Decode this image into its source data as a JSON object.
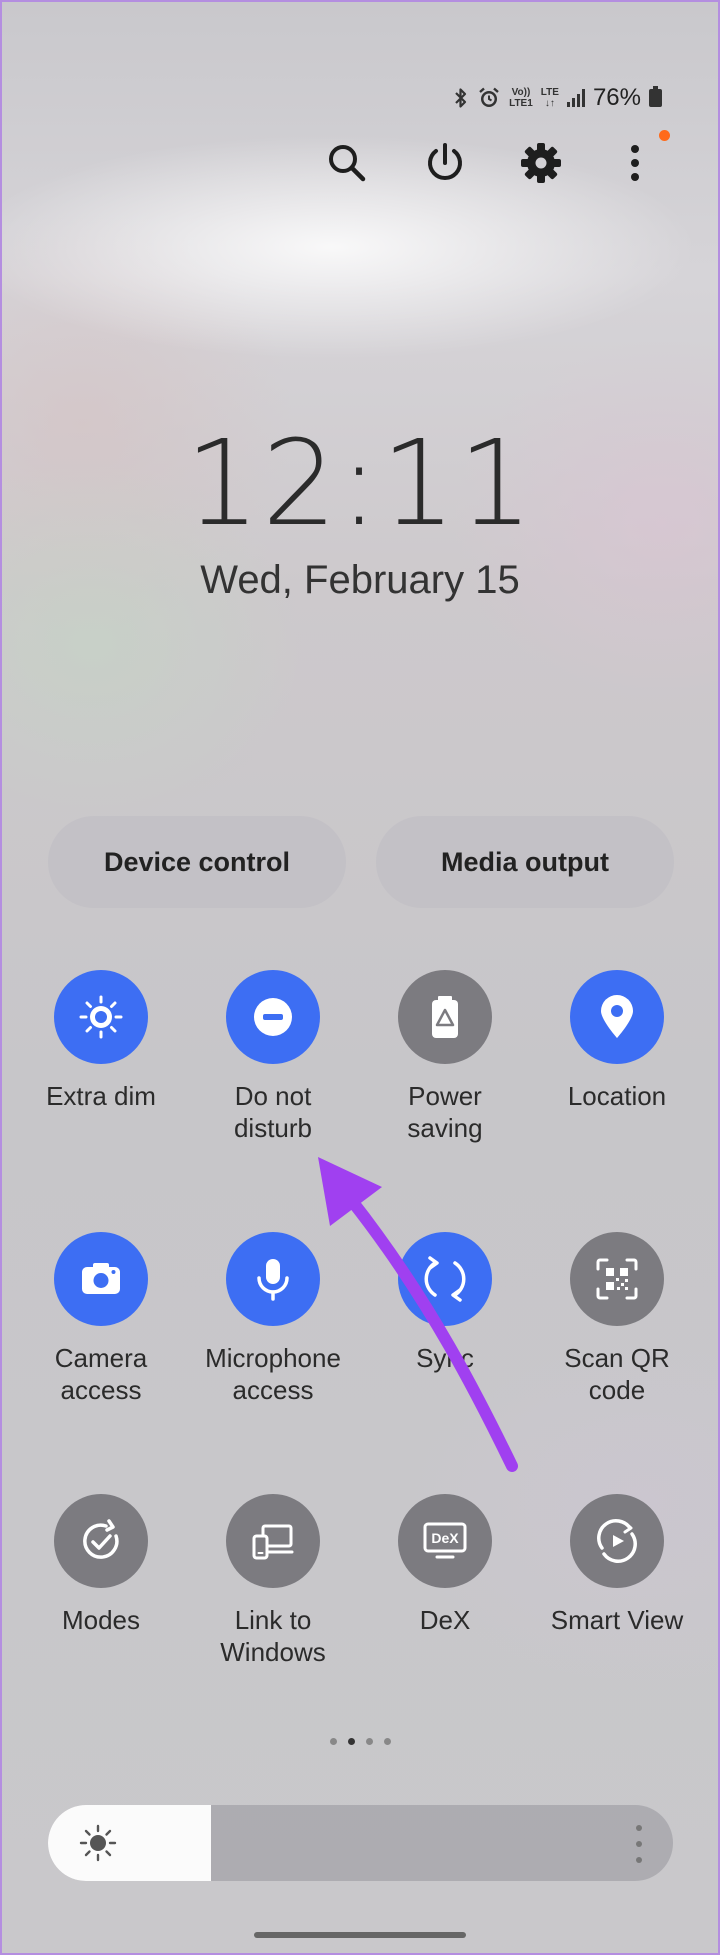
{
  "status_bar": {
    "volte_top": "Vo))",
    "volte_bottom": "LTE1",
    "network": "LTE",
    "battery_percent": "76%",
    "icons": [
      "bluetooth-icon",
      "alarm-icon",
      "volte-icon",
      "lte-icon",
      "signal-icon",
      "battery-icon"
    ]
  },
  "actions": {
    "icons": [
      "search-icon",
      "power-icon",
      "settings-gear-icon",
      "more-vertical-icon"
    ],
    "notification_dot_color": "#ff6a1a"
  },
  "clock": {
    "time": "12:11",
    "date": "Wed, February 15"
  },
  "pills": {
    "device_control": "Device control",
    "media_output": "Media output"
  },
  "tiles": [
    {
      "label": "Extra dim",
      "state": "on",
      "icon": "extra-dim-icon"
    },
    {
      "label": "Do not\ndisturb",
      "state": "on",
      "icon": "do-not-disturb-icon"
    },
    {
      "label": "Power\nsaving",
      "state": "off",
      "icon": "power-saving-icon"
    },
    {
      "label": "Location",
      "state": "on",
      "icon": "location-pin-icon"
    },
    {
      "label": "Camera\naccess",
      "state": "on",
      "icon": "camera-icon"
    },
    {
      "label": "Microphone\naccess",
      "state": "on",
      "icon": "microphone-icon"
    },
    {
      "label": "Sync",
      "state": "on",
      "icon": "sync-icon"
    },
    {
      "label": "Scan QR\ncode",
      "state": "off",
      "icon": "qr-code-icon"
    },
    {
      "label": "Modes",
      "state": "off",
      "icon": "modes-icon"
    },
    {
      "label": "Link to\nWindows",
      "state": "off",
      "icon": "link-to-windows-icon"
    },
    {
      "label": "DeX",
      "state": "off",
      "icon": "dex-icon"
    },
    {
      "label": "Smart View",
      "state": "off",
      "icon": "smart-view-icon"
    }
  ],
  "tile_icon_dex_text": "DeX",
  "pagination": {
    "count": 4,
    "active": 1
  },
  "brightness": {
    "level": 0.26
  },
  "colors": {
    "accent": "#3d6ef3",
    "tile_off": "#7c7b80",
    "annotation_arrow": "#a040f0"
  }
}
